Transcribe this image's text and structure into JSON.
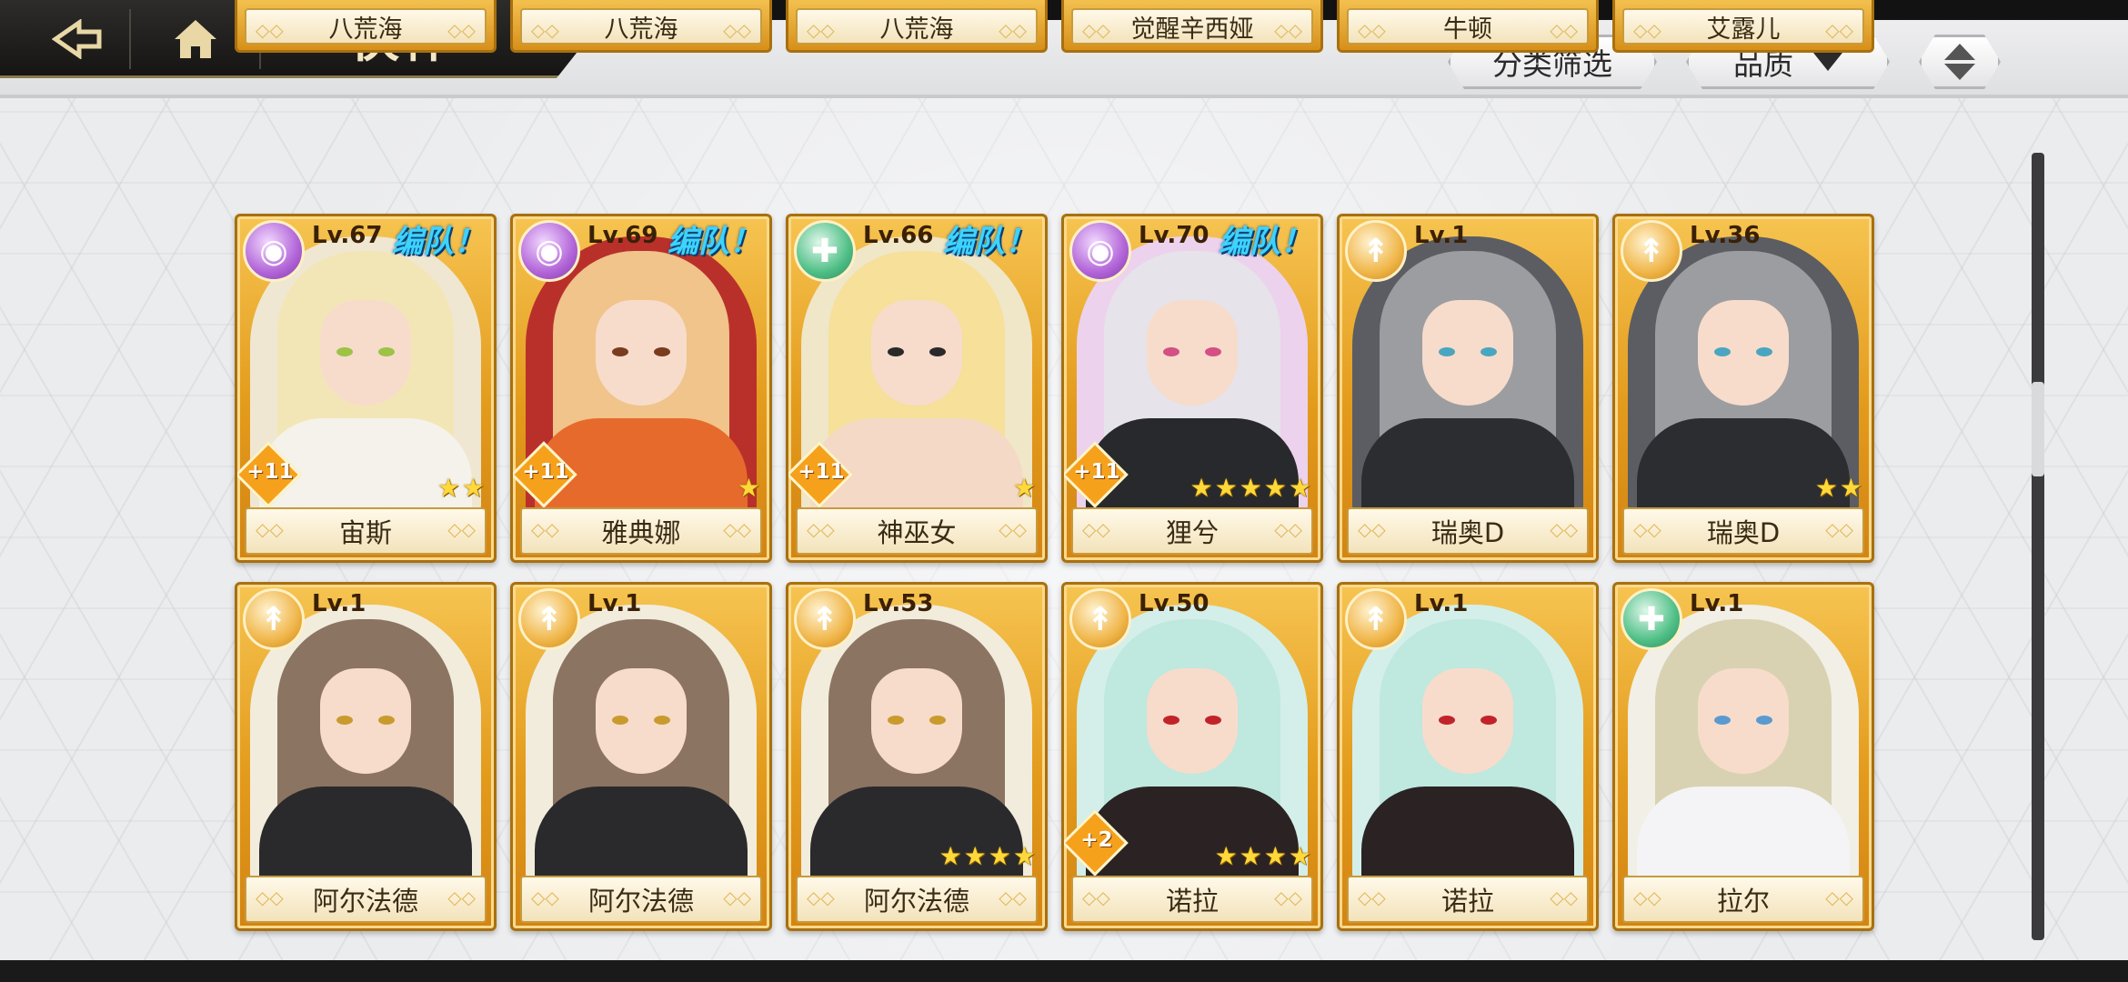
{
  "header": {
    "title": "伙伴",
    "filter_label": "分类筛选",
    "sort_label": "品质"
  },
  "top_row_names": [
    "八荒海",
    "八荒海",
    "八荒海",
    "觉醒辛西娅",
    "牛顿",
    "艾露儿"
  ],
  "cards": [
    {
      "name": "宙斯",
      "level": "Lv.67",
      "team": "编队！",
      "bonus": "+11",
      "stars": 2,
      "element": "dark",
      "hair": "#f3e6b6",
      "outfit": "#f4f2ea",
      "bg": "#efe7d2",
      "eye": "#9cc246"
    },
    {
      "name": "雅典娜",
      "level": "Lv.69",
      "team": "编队！",
      "bonus": "+11",
      "stars": 1,
      "element": "dark",
      "hair": "#f0c48a",
      "outfit": "#e66a2c",
      "bg": "#b9302b",
      "eye": "#7a3b1e"
    },
    {
      "name": "神巫女",
      "level": "Lv.66",
      "team": "编队！",
      "bonus": "+11",
      "stars": 1,
      "element": "nature",
      "hair": "#f6e09a",
      "outfit": "#f3d9c6",
      "bg": "#f0e6c8",
      "eye": "#2a2a2a"
    },
    {
      "name": "狸兮",
      "level": "Lv.70",
      "team": "编队！",
      "bonus": "+11",
      "stars": 5,
      "element": "dark",
      "hair": "#e6e3ea",
      "outfit": "#27292c",
      "bg": "#ecd2ec",
      "eye": "#d34f86"
    },
    {
      "name": "瑞奥D",
      "level": "Lv.1",
      "team": "",
      "bonus": "",
      "stars": 0,
      "element": "light",
      "hair": "#9c9da1",
      "outfit": "#2c2d31",
      "bg": "#5b5d62",
      "eye": "#4aa6c0"
    },
    {
      "name": "瑞奥D",
      "level": "Lv.36",
      "team": "",
      "bonus": "",
      "stars": 2,
      "element": "light",
      "hair": "#9c9da1",
      "outfit": "#2c2d31",
      "bg": "#5b5d62",
      "eye": "#4aa6c0"
    },
    {
      "name": "阿尔法德",
      "level": "Lv.1",
      "team": "",
      "bonus": "",
      "stars": 0,
      "element": "light",
      "hair": "#8b7462",
      "outfit": "#2a2a2c",
      "bg": "#f2ecdc",
      "eye": "#c99a2e"
    },
    {
      "name": "阿尔法德",
      "level": "Lv.1",
      "team": "",
      "bonus": "",
      "stars": 0,
      "element": "light",
      "hair": "#8b7462",
      "outfit": "#2a2a2c",
      "bg": "#f2ecdc",
      "eye": "#c99a2e"
    },
    {
      "name": "阿尔法德",
      "level": "Lv.53",
      "team": "",
      "bonus": "",
      "stars": 4,
      "element": "light",
      "hair": "#8b7462",
      "outfit": "#2a2a2c",
      "bg": "#f2ecdc",
      "eye": "#c99a2e"
    },
    {
      "name": "诺拉",
      "level": "Lv.50",
      "team": "",
      "bonus": "+2",
      "stars": 4,
      "element": "light",
      "hair": "#bfe8df",
      "outfit": "#2b2224",
      "bg": "#d4efe9",
      "eye": "#c2232b"
    },
    {
      "name": "诺拉",
      "level": "Lv.1",
      "team": "",
      "bonus": "",
      "stars": 0,
      "element": "light",
      "hair": "#bfe8df",
      "outfit": "#2b2224",
      "bg": "#d4efe9",
      "eye": "#c2232b"
    },
    {
      "name": "拉尔",
      "level": "Lv.1",
      "team": "",
      "bonus": "",
      "stars": 0,
      "element": "nature",
      "hair": "#d8d2b2",
      "outfit": "#f4f4f6",
      "bg": "#f1efe6",
      "eye": "#5b9ad1"
    }
  ],
  "element_glyphs": {
    "dark": "◉",
    "light": "↟",
    "nature": "✚"
  },
  "colors": {
    "accent_gold": "#e39b1c",
    "team_tag": "#3dd3ff",
    "title": "#f4e7c5"
  }
}
